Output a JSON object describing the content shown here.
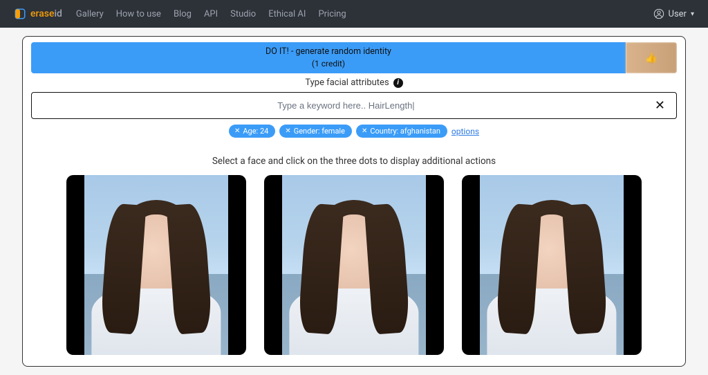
{
  "nav": {
    "brand_erase": "erase",
    "brand_id": "id",
    "links": [
      "Gallery",
      "How to use",
      "Blog",
      "API",
      "Studio",
      "Ethical AI",
      "Pricing"
    ],
    "user_label": "User"
  },
  "doit": {
    "line1": "DO IT! - generate random identity",
    "line2": "(1 credit)"
  },
  "attributes_label": "Type facial attributes",
  "keyword": {
    "placeholder": "Type a keyword here.. HairLength|",
    "value": ""
  },
  "chips": [
    {
      "label": "Age: 24"
    },
    {
      "label": "Gender: female"
    },
    {
      "label": "Country: afghanistan"
    }
  ],
  "options_text": "options",
  "instruction": "Select a face and click on the three dots to display additional actions"
}
